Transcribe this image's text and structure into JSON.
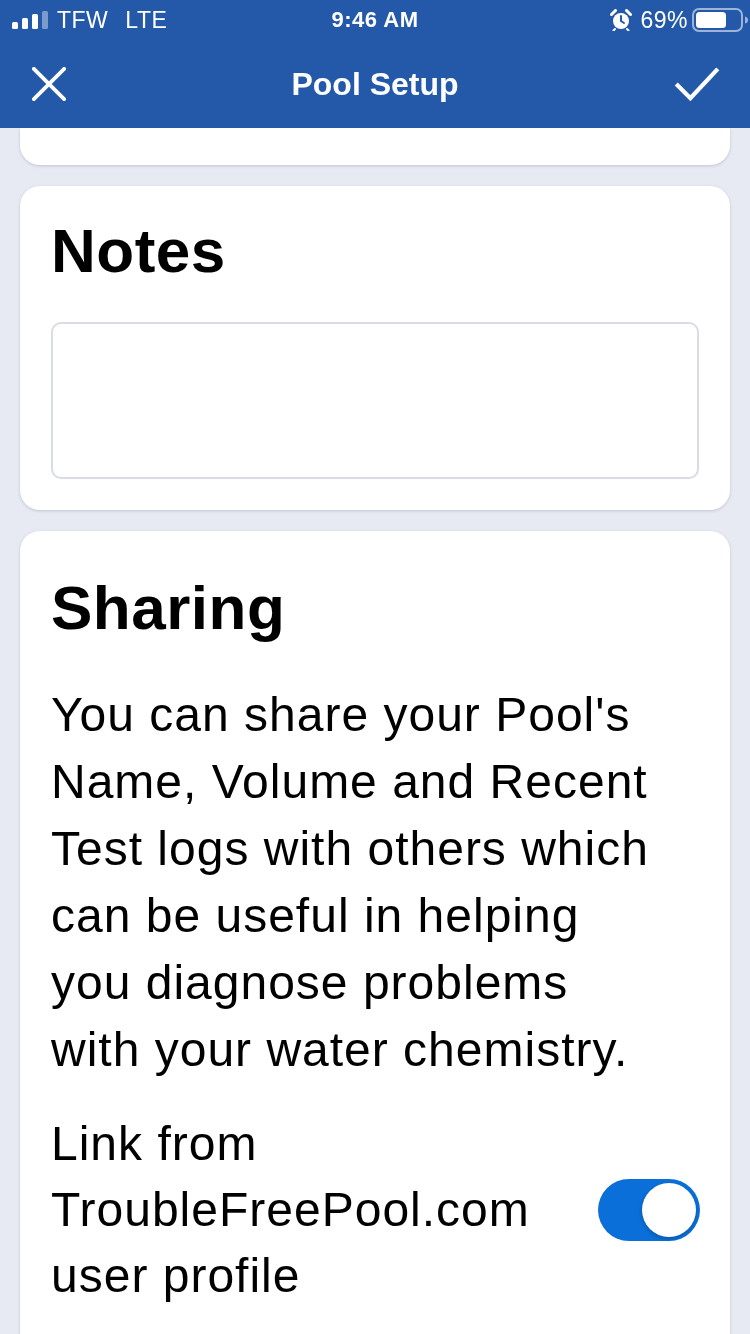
{
  "status_bar": {
    "carrier": "TFW",
    "network": "LTE",
    "time": "9:46 AM",
    "battery": "69%"
  },
  "nav_bar": {
    "title": "Pool Setup"
  },
  "notes": {
    "title": "Notes"
  },
  "sharing": {
    "title": "Sharing",
    "description": "You can share your Pool's Name, Volume and Recent Test logs with others which can be useful in helping you diagnose problems with your water chemistry.",
    "toggle": {
      "label": "Link from TroubleFreePool.com user profile",
      "on": true
    }
  }
}
